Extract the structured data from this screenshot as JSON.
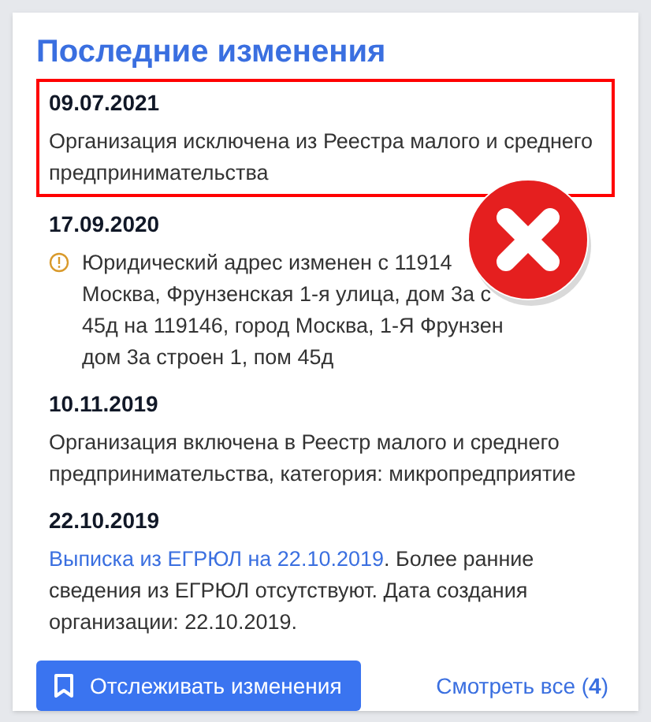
{
  "title": "Последние изменения",
  "changes": [
    {
      "date": "09.07.2021",
      "highlighted": true,
      "warning": false,
      "lines": [
        "Организация исключена из Реестра малого и среднего предпринимательства"
      ]
    },
    {
      "date": "17.09.2020",
      "highlighted": false,
      "warning": true,
      "lines": [
        "Юридический адрес изменен с 11914",
        "Москва, Фрунзенская 1-я улица, дом 3а с",
        "45д на 119146, город Москва, 1-Я Фрунзен",
        "дом 3а строен 1, пом 45д"
      ]
    },
    {
      "date": "10.11.2019",
      "highlighted": false,
      "warning": false,
      "lines": [
        "Организация включена в Реестр малого и среднего предпринимательства, категория: микропредприятие"
      ]
    },
    {
      "date": "22.10.2019",
      "highlighted": false,
      "warning": false,
      "link": "Выписка из ЕГРЮЛ на 22.10.2019",
      "lines": [
        ". Более ранние сведения из ЕГРЮЛ отсутствуют. Дата создания организации: 22.10.2019."
      ]
    }
  ],
  "track_button": "Отслеживать изменения",
  "view_all": "Смотреть все (**4**)"
}
